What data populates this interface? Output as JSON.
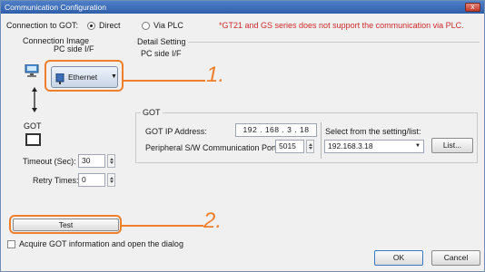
{
  "window": {
    "title": "Communication Configuration",
    "close": "x"
  },
  "connection": {
    "label": "Connection to GOT:",
    "direct": "Direct",
    "via_plc": "Via PLC",
    "warning": "*GT21 and GS series does not support the communication via PLC."
  },
  "image_section": {
    "label": "Connection Image",
    "pc_side": "PC side I/F",
    "ethernet": "Ethernet",
    "got": "GOT"
  },
  "detail": {
    "label": "Detail Setting",
    "pc_side": "PC side I/F"
  },
  "got_group": {
    "label": "GOT",
    "ip_label": "GOT IP Address:",
    "ip_parts": [
      "192",
      "168",
      "3",
      "18"
    ],
    "port_label": "Peripheral S/W Communication Port No.:",
    "port_value": "5015",
    "select_label": "Select from the setting/list:",
    "select_value": "192.168.3.18",
    "list_button": "List..."
  },
  "timeout": {
    "label": "Timeout (Sec):",
    "value": "30"
  },
  "retry": {
    "label": "Retry Times:",
    "value": "0"
  },
  "test_button": "Test",
  "acquire": {
    "label": "Acquire GOT information and open the dialog"
  },
  "ok_button": "OK",
  "cancel_button": "Cancel",
  "callouts": [
    "1.",
    "2."
  ],
  "colors": {
    "callout": "#f07f2c",
    "warning": "#d0282a",
    "titlebar": "#3b6cb8"
  }
}
